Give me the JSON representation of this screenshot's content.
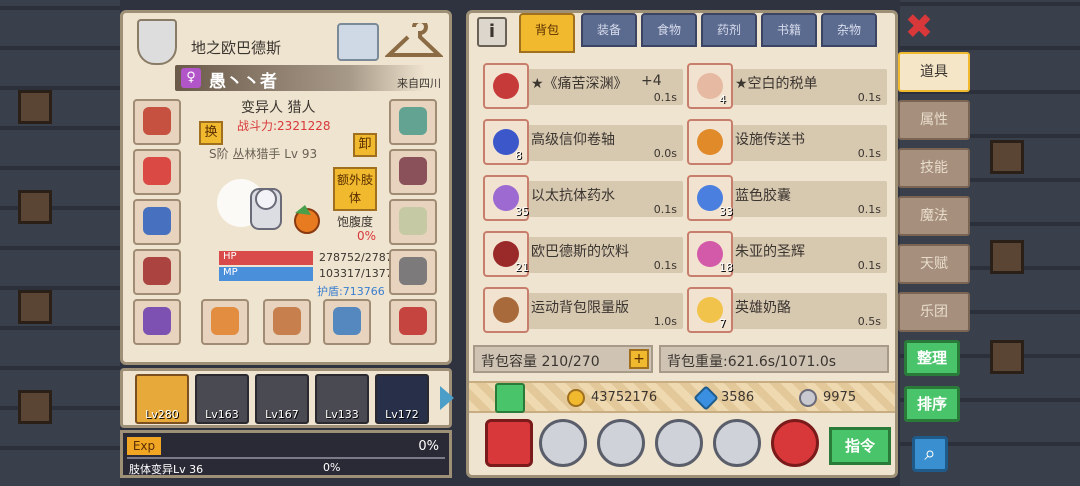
{
  "header": {
    "title": "地之欧巴德斯"
  },
  "character": {
    "name": "愚丶丶者",
    "gender_icon": "female-symbol",
    "server": "来自四川",
    "class": "变异人 猎人",
    "power": "战斗力:2321228",
    "subclass": "S阶 丛林猎手 Lv 93",
    "swap_label": "换",
    "unload_label": "卸",
    "extra_limb_label": "额外肢体",
    "satiety_label": "饱腹度",
    "satiety_value": "0%",
    "hp_label": "HP",
    "hp_value": "278752/2787",
    "mp_label": "MP",
    "mp_value": "103317/1377",
    "shield_value": "护盾:713766"
  },
  "team": [
    {
      "level": "Lv280",
      "active": true
    },
    {
      "level": "Lv163"
    },
    {
      "level": "Lv167"
    },
    {
      "level": "Lv133"
    },
    {
      "level": "Lv172",
      "wing": true
    }
  ],
  "exp": {
    "label": "Exp",
    "percent": "0%",
    "limb_text": "肢体变异Lv 36",
    "limb_percent": "0%"
  },
  "bag": {
    "info_icon": "info-icon",
    "tabs": [
      "背包",
      "装备",
      "食物",
      "药剂",
      "书籍",
      "杂物"
    ],
    "items": [
      {
        "name": "★《痛苦深渊》",
        "extra": "+4",
        "time": "0.1s",
        "count": "",
        "color": "#c73a3a"
      },
      {
        "name": "★空白的税单",
        "time": "0.1s",
        "count": "4",
        "color": "#e6b9a2"
      },
      {
        "name": "高级信仰卷轴",
        "time": "0.0s",
        "count": "8",
        "color": "#3b57c9"
      },
      {
        "name": "设施传送书",
        "time": "0.1s",
        "count": "",
        "color": "#e08a2a"
      },
      {
        "name": "以太抗体药水",
        "time": "0.1s",
        "count": "35",
        "color": "#9c6ad0"
      },
      {
        "name": "蓝色胶囊",
        "time": "0.1s",
        "count": "33",
        "color": "#4a7fe0"
      },
      {
        "name": "欧巴德斯的饮料",
        "time": "0.1s",
        "count": "21",
        "color": "#9a2a2a"
      },
      {
        "name": "朱亚的圣辉",
        "time": "0.1s",
        "count": "18",
        "color": "#d35aa8"
      },
      {
        "name": "运动背包限量版",
        "time": "1.0s",
        "count": "",
        "color": "#a86a3a"
      },
      {
        "name": "英雄奶酪",
        "time": "0.5s",
        "count": "7",
        "color": "#f2c34a"
      }
    ],
    "capacity": "背包容量 210/270",
    "weight": "背包重量:621.6s/1071.0s",
    "gold": "43752176",
    "diamond": "3586",
    "silver": "9975",
    "command_label": "指令"
  },
  "side_tabs": [
    "道具",
    "属性",
    "技能",
    "魔法",
    "天赋",
    "乐团"
  ],
  "side_buttons": {
    "organize": "整理",
    "sort": "排序"
  },
  "colors": {
    "accent": "#f0b92e",
    "green": "#4ac46a",
    "red": "#d8383a",
    "panel": "#efe4cf"
  }
}
